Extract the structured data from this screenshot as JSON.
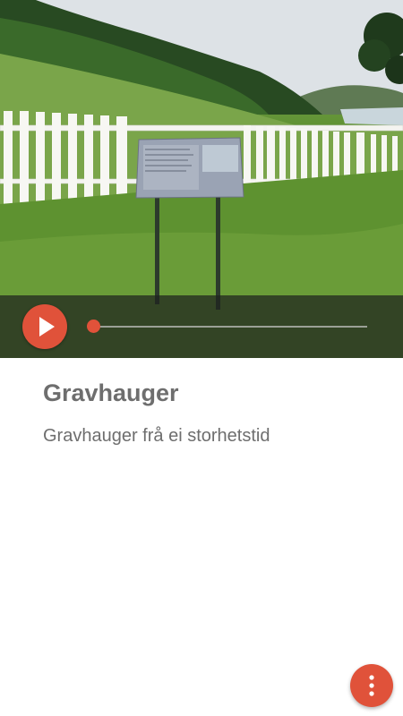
{
  "story": {
    "title": "Gravhauger",
    "subtitle": "Gravhauger frå ei storhetstid"
  },
  "player": {
    "progress": 0,
    "play_icon": "play-icon"
  },
  "menu": {
    "icon": "more-vertical-icon"
  },
  "colors": {
    "accent": "#e0523a",
    "text": "#6e6e6e",
    "background": "#ffffff"
  }
}
